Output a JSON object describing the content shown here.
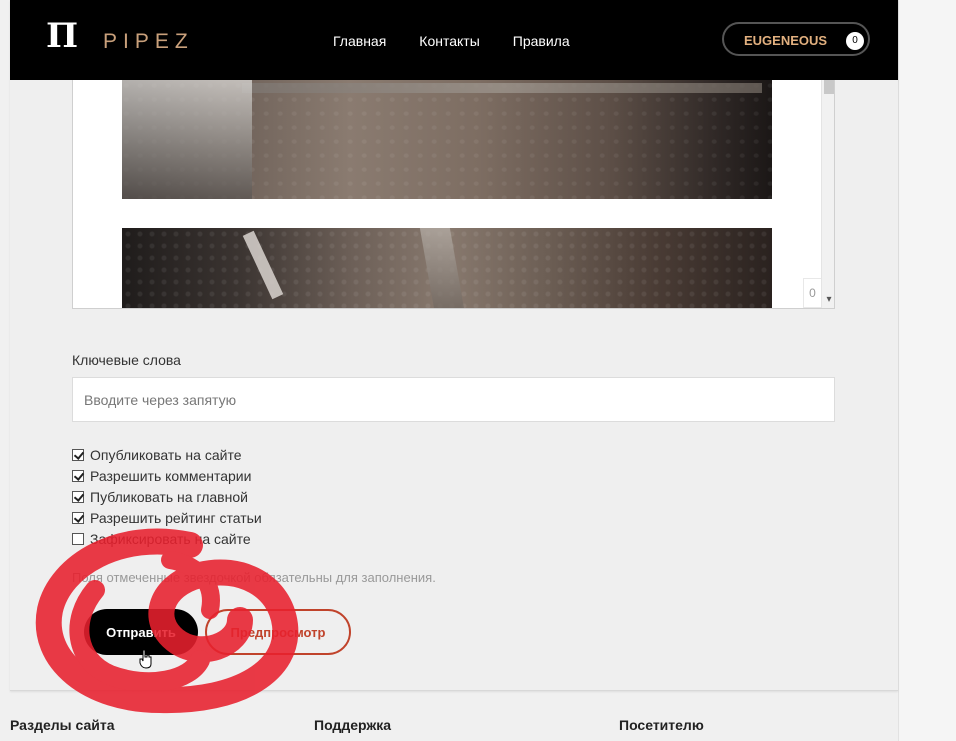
{
  "header": {
    "logo_mark": "П",
    "logo_text": "PIPEZ",
    "nav": [
      "Главная",
      "Контакты",
      "Правила"
    ],
    "user_name": "EUGENEOUS",
    "user_count": "0"
  },
  "editor": {
    "char_count": "0"
  },
  "keywords": {
    "label": "Ключевые слова",
    "placeholder": "Вводите через запятую"
  },
  "options": [
    {
      "label": "Опубликовать на сайте",
      "checked": true
    },
    {
      "label": "Разрешить комментарии",
      "checked": true
    },
    {
      "label": "Публиковать на главной",
      "checked": true
    },
    {
      "label": "Разрешить рейтинг статьи",
      "checked": true
    },
    {
      "label": "Зафиксировать на сайте",
      "checked": false
    }
  ],
  "form": {
    "required_note": "Поля отмеченные звездочкой обязательны для заполнения.",
    "submit_label": "Отправить",
    "preview_label": "Предпросмотр"
  },
  "footer": {
    "columns": [
      "Разделы сайта",
      "Поддержка",
      "Посетителю"
    ]
  },
  "colors": {
    "accent_gold": "#c9a07b",
    "preview_red": "#c0432b",
    "scribble_red": "#e8202e"
  }
}
